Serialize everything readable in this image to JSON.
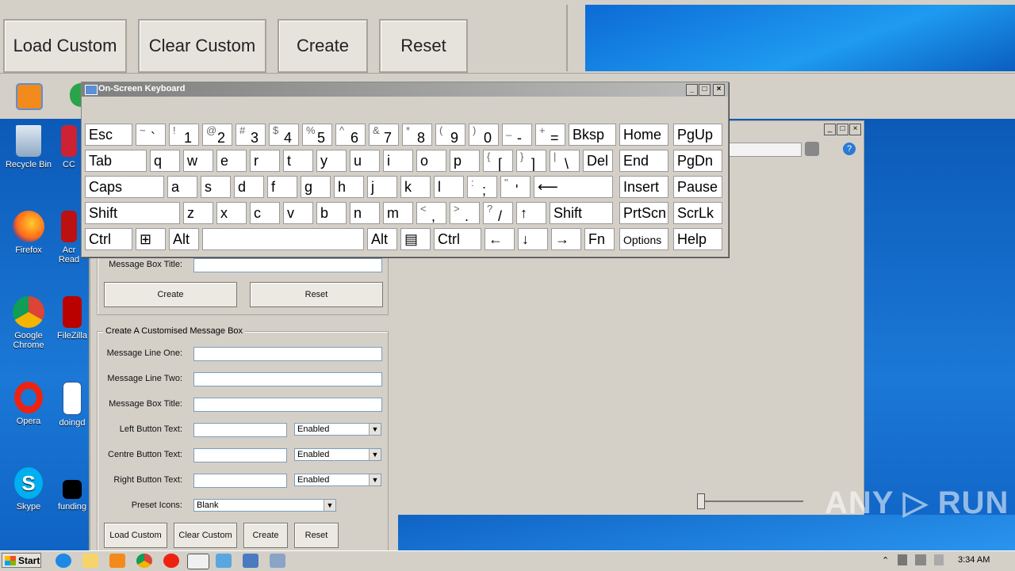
{
  "big_window": {
    "buttons": [
      "Load Custom",
      "Clear Custom",
      "Create",
      "Reset"
    ]
  },
  "desktop_icons": [
    {
      "label": "Recycle Bin",
      "icon": "recycle-bin-icon"
    },
    {
      "label": "CC",
      "icon": "ccleaner-icon"
    },
    {
      "label": "Firefox",
      "icon": "firefox-icon"
    },
    {
      "label": "Acr Read",
      "icon": "acrobat-reader-icon"
    },
    {
      "label": "Google Chrome",
      "icon": "chrome-icon"
    },
    {
      "label": "FileZilla",
      "icon": "filezilla-icon"
    },
    {
      "label": "Opera",
      "icon": "opera-icon"
    },
    {
      "label": "doingd",
      "icon": "word-doc-icon"
    },
    {
      "label": "Skype",
      "icon": "skype-icon"
    },
    {
      "label": "funding",
      "icon": "black-file-icon"
    }
  ],
  "osk": {
    "title": "On-Screen Keyboard",
    "rows": [
      [
        {
          "t": "Esc"
        },
        {
          "s": "~",
          "m": "`"
        },
        {
          "s": "!",
          "m": "1"
        },
        {
          "s": "@",
          "m": "2"
        },
        {
          "s": "#",
          "m": "3"
        },
        {
          "s": "$",
          "m": "4"
        },
        {
          "s": "%",
          "m": "5"
        },
        {
          "s": "^",
          "m": "6"
        },
        {
          "s": "&",
          "m": "7"
        },
        {
          "s": "*",
          "m": "8"
        },
        {
          "s": "(",
          "m": "9"
        },
        {
          "s": ")",
          "m": "0"
        },
        {
          "s": "_",
          "m": "-"
        },
        {
          "s": "+",
          "m": "="
        },
        {
          "t": "Bksp"
        },
        {
          "t": "Home"
        },
        {
          "t": "PgUp"
        }
      ],
      [
        {
          "t": "Tab"
        },
        {
          "t": "q"
        },
        {
          "t": "w"
        },
        {
          "t": "e"
        },
        {
          "t": "r"
        },
        {
          "t": "t"
        },
        {
          "t": "y"
        },
        {
          "t": "u"
        },
        {
          "t": "i"
        },
        {
          "t": "o"
        },
        {
          "t": "p"
        },
        {
          "s": "{",
          "m": "["
        },
        {
          "s": "}",
          "m": "]"
        },
        {
          "s": "|",
          "m": "\\"
        },
        {
          "t": "Del"
        },
        {
          "t": "End"
        },
        {
          "t": "PgDn"
        }
      ],
      [
        {
          "t": "Caps"
        },
        {
          "t": "a"
        },
        {
          "t": "s"
        },
        {
          "t": "d"
        },
        {
          "t": "f"
        },
        {
          "t": "g"
        },
        {
          "t": "h"
        },
        {
          "t": "j"
        },
        {
          "t": "k"
        },
        {
          "t": "l"
        },
        {
          "s": ":",
          "m": ";"
        },
        {
          "s": "\"",
          "m": "'"
        },
        {
          "t": "⟵"
        },
        {
          "t": "Insert"
        },
        {
          "t": "Pause"
        }
      ],
      [
        {
          "t": "Shift"
        },
        {
          "t": "z"
        },
        {
          "t": "x"
        },
        {
          "t": "c"
        },
        {
          "t": "v"
        },
        {
          "t": "b"
        },
        {
          "t": "n"
        },
        {
          "t": "m"
        },
        {
          "s": "<",
          "m": ","
        },
        {
          "s": ">",
          "m": "."
        },
        {
          "s": "?",
          "m": "/"
        },
        {
          "t": "↑"
        },
        {
          "t": "Shift"
        },
        {
          "t": "PrtScn"
        },
        {
          "t": "ScrLk"
        }
      ],
      [
        {
          "t": "Ctrl"
        },
        {
          "t": "⊞"
        },
        {
          "t": "Alt"
        },
        {
          "t": ""
        },
        {
          "t": "Alt"
        },
        {
          "t": "▤"
        },
        {
          "t": "Ctrl"
        },
        {
          "t": "←"
        },
        {
          "t": "↓"
        },
        {
          "t": "→"
        },
        {
          "t": "Fn"
        },
        {
          "t": "Options"
        },
        {
          "t": "Help"
        }
      ]
    ]
  },
  "form": {
    "top": {
      "message_box_title_label": "Message Box Title:",
      "create": "Create",
      "reset": "Reset"
    },
    "custom_group": {
      "title": "Create A Customised Message Box",
      "line_one_label": "Message Line One:",
      "line_two_label": "Message Line Two:",
      "title_label": "Message Box Title:",
      "left_label": "Left Button Text:",
      "centre_label": "Centre Button Text:",
      "right_label": "Right Button Text:",
      "state_value": "Enabled",
      "preset_label": "Preset Icons:",
      "preset_value": "Blank",
      "load": "Load Custom",
      "clear": "Clear Custom",
      "create": "Create",
      "reset": "Reset"
    }
  },
  "taskbar": {
    "start": "Start",
    "clock": "3:34 AM"
  },
  "watermark": "ANY ▷ RUN"
}
